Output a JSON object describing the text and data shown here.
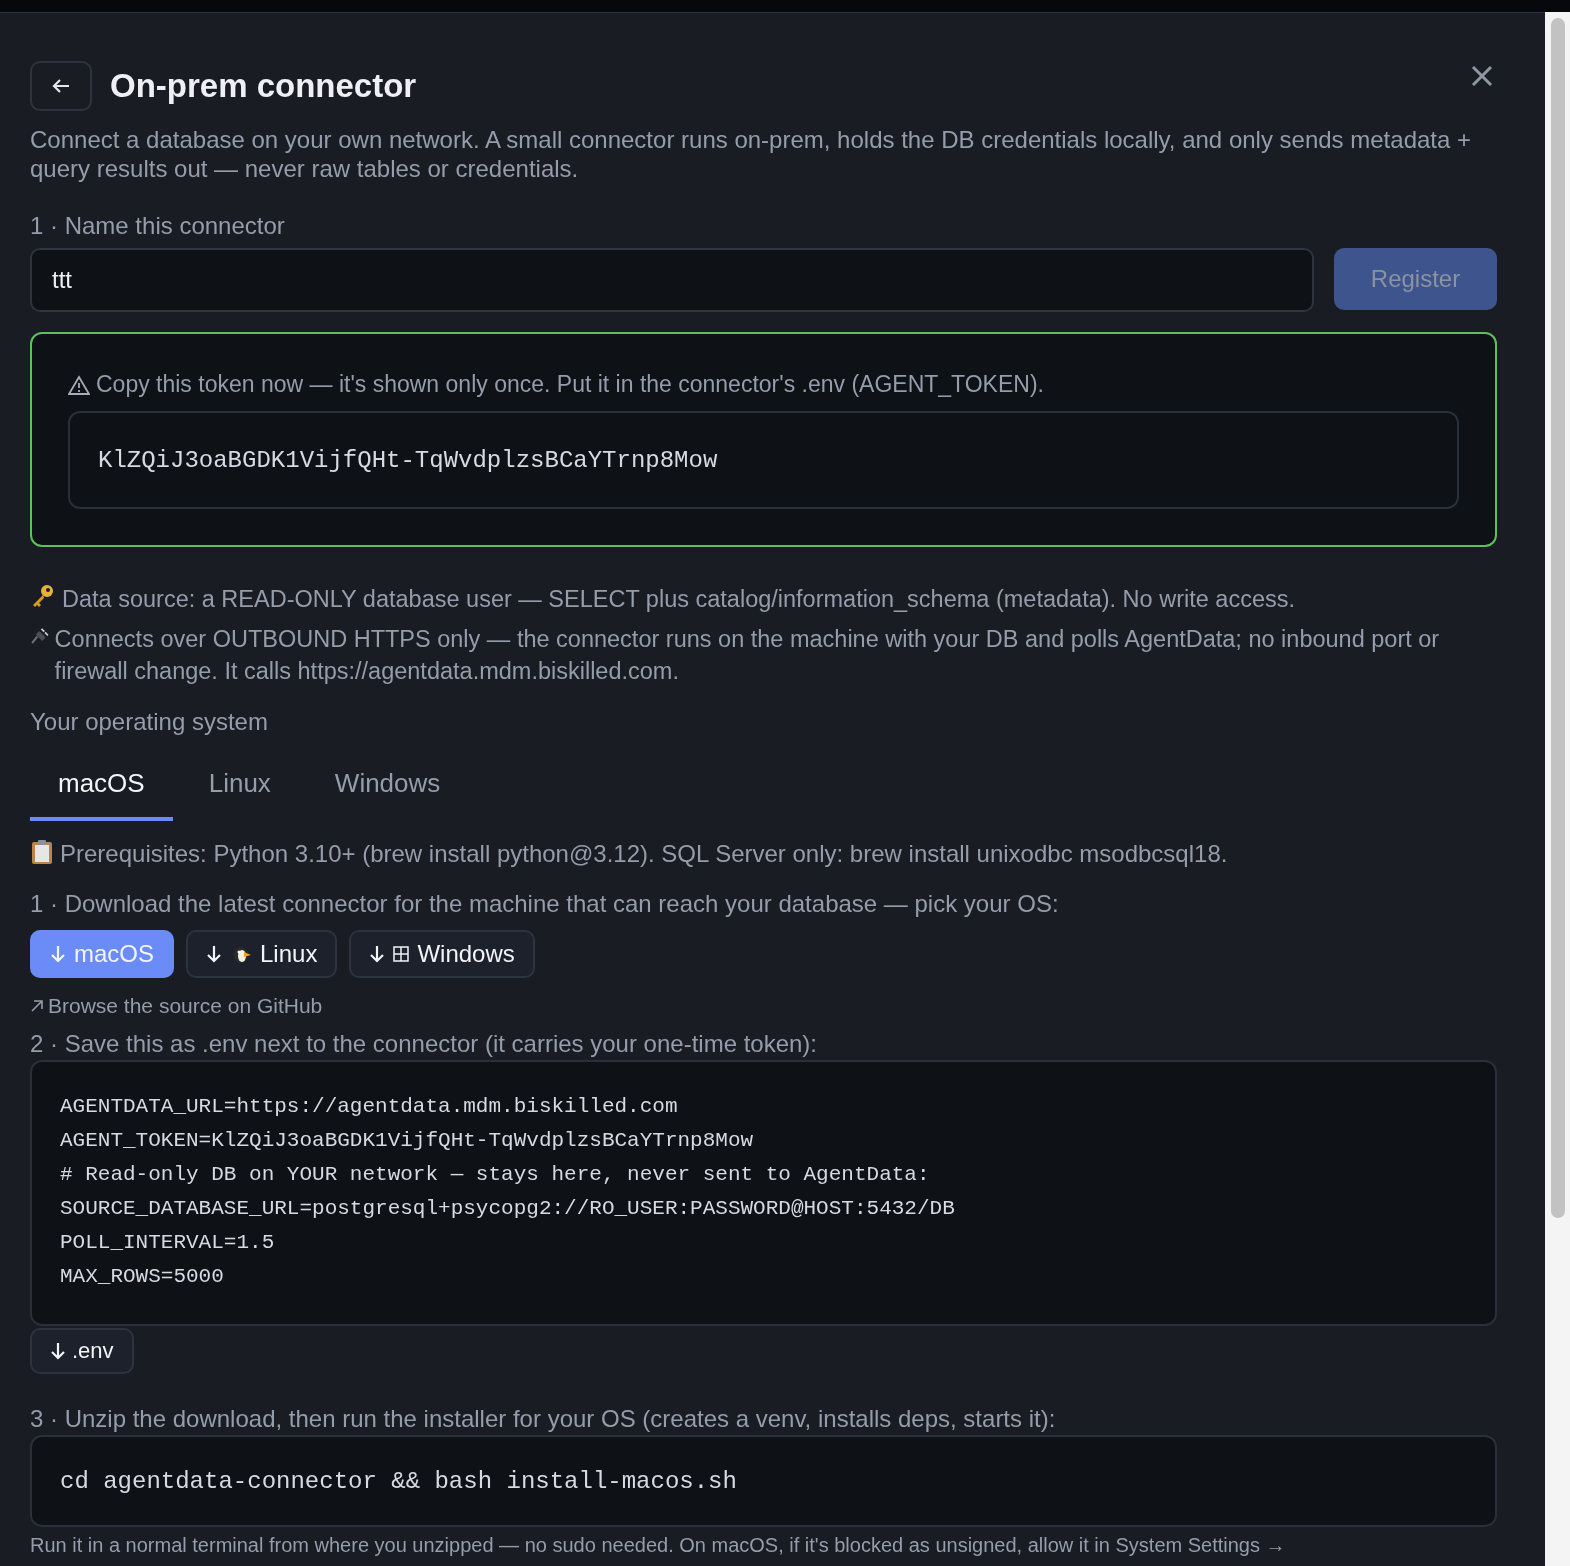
{
  "dialog": {
    "title": "On-prem connector",
    "description": "Connect a database on your own network. A small connector runs on-prem, holds the DB credentials locally, and only sends metadata + query results out — never raw tables or credentials."
  },
  "name_step": {
    "label": "1 · Name this connector",
    "value": "ttt",
    "button": {
      "label": "Register",
      "disabled": true
    }
  },
  "token_panel": {
    "warning": "Copy this token now — it's shown only once. Put it in the connector's .env (AGENT_TOKEN).",
    "token": "KlZQiJ3oaBGDK1VijfQHt-TqWvdplzsBCaYTrnp8Mow"
  },
  "notes": [
    {
      "kind": "key",
      "text": "Data source: a READ-ONLY database user — SELECT plus catalog/information_schema (metadata). No write access."
    },
    {
      "kind": "plug",
      "text": "Connects over OUTBOUND HTTPS only — the connector runs on the machine with your DB and polls AgentData; no inbound port or firewall change. It calls https://agentdata.mdm.biskilled.com."
    }
  ],
  "os_label": "Your operating system",
  "tabs": [
    {
      "label": "macOS",
      "selected": true
    },
    {
      "label": "Linux",
      "selected": false
    },
    {
      "label": "Windows",
      "selected": false
    }
  ],
  "prerequisites": "Prerequisites: Python 3.10+ (brew install python@3.12). SQL Server only: brew install unixodbc msodbcsql18.",
  "download_step": {
    "label": "1 · Download the latest connector for the machine that can reach your database — pick your OS:",
    "buttons": [
      {
        "kind": "mac",
        "label": "macOS",
        "selected": true
      },
      {
        "kind": "linux",
        "label": "Linux",
        "selected": false
      },
      {
        "kind": "windows",
        "label": "Windows",
        "selected": false
      }
    ],
    "link": "Browse the source on GitHub"
  },
  "env_step": {
    "label": "2 · Save this as .env next to the connector (it carries your one-time token):",
    "lines": [
      "AGENTDATA_URL=https://agentdata.mdm.biskilled.com",
      "AGENT_TOKEN=KlZQiJ3oaBGDK1VijfQHt-TqWvdplzsBCaYTrnp8Mow",
      "# Read-only DB on YOUR network — stays here, never sent to AgentData:",
      "SOURCE_DATABASE_URL=postgresql+psycopg2://RO_USER:PASSWORD@HOST:5432/DB",
      "POLL_INTERVAL=1.5",
      "MAX_ROWS=5000"
    ],
    "button": ".env"
  },
  "install_step": {
    "label": "3 · Unzip the download, then run the installer for your OS (creates a venv, installs deps, starts it):",
    "command": "cd agentdata-connector && bash install-macos.sh",
    "note": "Run it in a normal terminal from where you unzipped — no sudo needed. On macOS, if it's blocked as unsigned, allow it in System Settings →"
  }
}
